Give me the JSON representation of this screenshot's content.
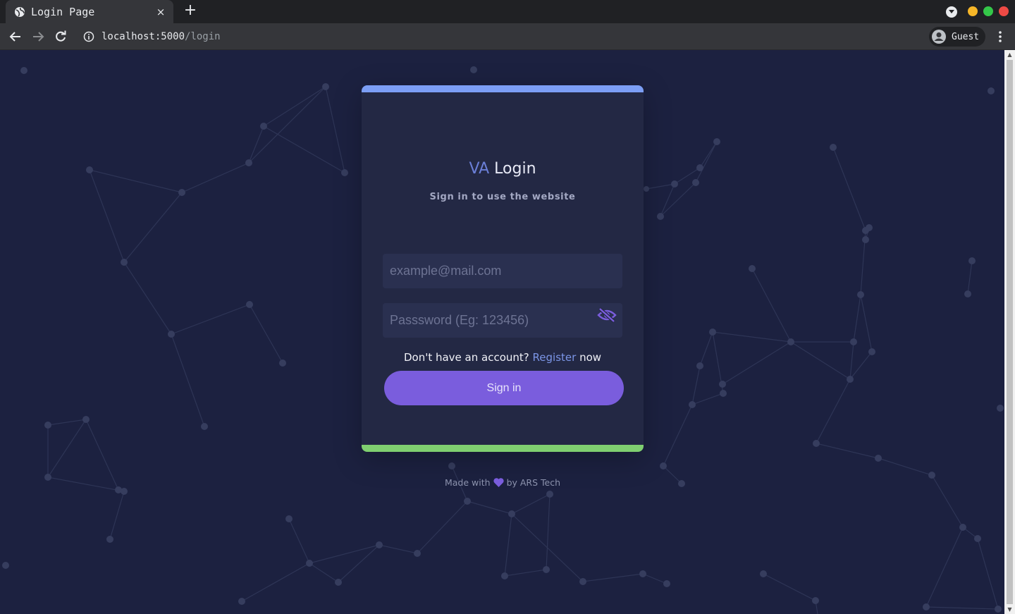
{
  "browser": {
    "tab_title": "Login Page",
    "tab_close": "×",
    "new_tab": "+",
    "url_host": "localhost:5000",
    "url_path": "/login",
    "profile_label": "Guest"
  },
  "login": {
    "brand": "VA",
    "title": "Login",
    "subtitle": "Sign in to use the website",
    "email_placeholder": "example@mail.com",
    "password_placeholder": "Passsword (Eg: 123456)",
    "register_prefix": "Don't have an account?",
    "register_link": "Register",
    "register_suffix": "now",
    "signin_label": "Sign in"
  },
  "footer": {
    "prefix": "Made with",
    "suffix": "by ARS Tech"
  },
  "colors": {
    "page_bg": "#1c2140",
    "card_bg": "#232844",
    "top_bar": "#7c9ef5",
    "bottom_bar": "#7fcf70",
    "button": "#7a5ddd",
    "link": "#7b95e6",
    "brand": "#6b7fd7"
  },
  "icons": {
    "tab_favicon": "globe-icon",
    "back": "arrow-left-icon",
    "forward": "arrow-right-icon",
    "reload": "reload-icon",
    "site_info": "info-icon",
    "profile": "account-circle-icon",
    "menu": "more-vert-icon",
    "password_toggle": "eye-off-icon",
    "footer_heart": "heart-icon"
  }
}
